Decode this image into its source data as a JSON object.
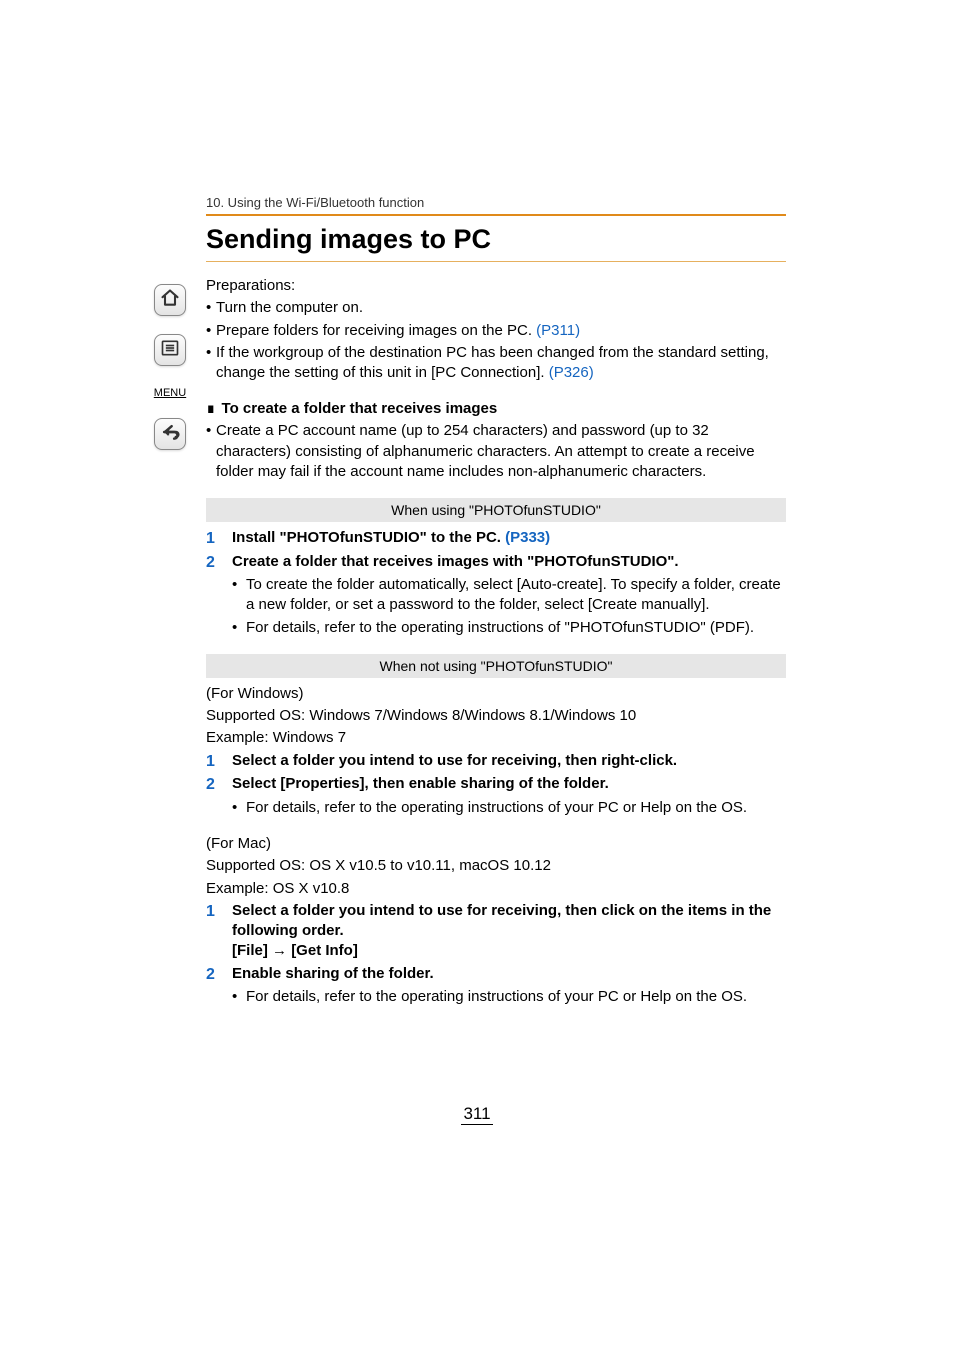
{
  "chapter": "10. Using the Wi-Fi/Bluetooth function",
  "title": "Sending images to PC",
  "prep_label": "Preparations:",
  "prep": {
    "b1": "Turn the computer on.",
    "b2a": "Prepare folders for receiving images on the PC. ",
    "b2link": "(P311)",
    "b3a": "If the workgroup of the destination PC has been changed from the standard setting, change the setting of this unit in [PC Connection]. ",
    "b3link": "(P326)"
  },
  "create_folder_heading": "To create a folder that receives images",
  "create_folder_note": "Create a PC account name (up to 254 characters) and password (up to 32 characters) consisting of alphanumeric characters. An attempt to create a receive folder may fail if the account name includes non-alphanumeric characters.",
  "bar1": "When using \"PHOTOfunSTUDIO\"",
  "s1": {
    "n1a": "Install \"PHOTOfunSTUDIO\" to the PC. ",
    "n1link": "(P333)",
    "n2": "Create a folder that receives images with \"PHOTOfunSTUDIO\".",
    "n2b1": "To create the folder automatically, select [Auto-create]. To specify a folder, create a new folder, or set a password to the folder, select [Create manually].",
    "n2b2": "For details, refer to the operating instructions of \"PHOTOfunSTUDIO\" (PDF)."
  },
  "bar2": "When not using \"PHOTOfunSTUDIO\"",
  "win": {
    "heading": "(For Windows)",
    "os": "Supported OS: Windows 7/Windows 8/Windows 8.1/Windows 10",
    "example": "Example: Windows 7",
    "n1": "Select a folder you intend to use for receiving, then right-click.",
    "n2": "Select [Properties], then enable sharing of the folder.",
    "n2b1": "For details, refer to the operating instructions of your PC or Help on the OS."
  },
  "mac": {
    "heading": "(For Mac)",
    "os": "Supported OS: OS X v10.5 to v10.11, macOS 10.12",
    "example": "Example: OS X v10.8",
    "n1": "Select a folder you intend to use for receiving, then click on the items in the following order.",
    "n1path_a": "[File]",
    "n1path_b": "[Get Info]",
    "n2": "Enable sharing of the folder.",
    "n2b1": "For details, refer to the operating instructions of your PC or Help on the OS."
  },
  "page_number": "311",
  "nav": {
    "menu": "MENU"
  }
}
